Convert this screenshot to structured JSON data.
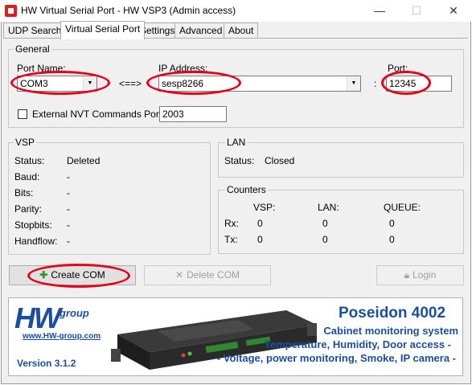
{
  "window": {
    "title": "HW Virtual Serial Port - HW VSP3 (Admin access)",
    "minimize": "—",
    "maximize": "☐",
    "close": "✕"
  },
  "tabs": [
    {
      "label": "UDP Search",
      "active": false
    },
    {
      "label": "Virtual Serial Port",
      "active": true
    },
    {
      "label": "Settings",
      "active": false
    },
    {
      "label": "Advanced",
      "active": false
    },
    {
      "label": "About",
      "active": false
    }
  ],
  "general": {
    "legend": "General",
    "port_name_label": "Port Name:",
    "port_name_value": "COM3",
    "arrow": "<==>",
    "ip_label": "IP Address:",
    "ip_value": "sesp8266",
    "colon": ":",
    "port_label": "Port:",
    "port_value": "12345",
    "nvt_label": "External NVT Commands Port:",
    "nvt_value": "2003"
  },
  "vsp": {
    "legend": "VSP",
    "rows": [
      {
        "label": "Status:",
        "value": "Deleted"
      },
      {
        "label": "Baud:",
        "value": "-"
      },
      {
        "label": "Bits:",
        "value": "-"
      },
      {
        "label": "Parity:",
        "value": "-"
      },
      {
        "label": "Stopbits:",
        "value": "-"
      },
      {
        "label": "Handflow:",
        "value": "-"
      }
    ]
  },
  "lan": {
    "legend": "LAN",
    "status_label": "Status:",
    "status_value": "Closed"
  },
  "counters": {
    "legend": "Counters",
    "headers": [
      "VSP:",
      "LAN:",
      "QUEUE:"
    ],
    "rows": [
      {
        "label": "Rx:",
        "values": [
          "0",
          "0",
          "0"
        ]
      },
      {
        "label": "Tx:",
        "values": [
          "0",
          "0",
          "0"
        ]
      }
    ]
  },
  "buttons": {
    "create": "Create COM",
    "delete": "Delete COM",
    "login": "Login"
  },
  "banner": {
    "logo_big": "HW",
    "logo_group": "group",
    "url": "www.HW-group.com",
    "version": "Version  3.1.2",
    "product": "Poseidon 4002",
    "lines": [
      "Cabinet monitoring system",
      "Temperature, Humidity, Door access -",
      "- Voltage, power monitoring, Smoke, IP camera -"
    ]
  },
  "colors": {
    "highlight": "#e3001b",
    "brand_blue": "#1a4fa0"
  }
}
